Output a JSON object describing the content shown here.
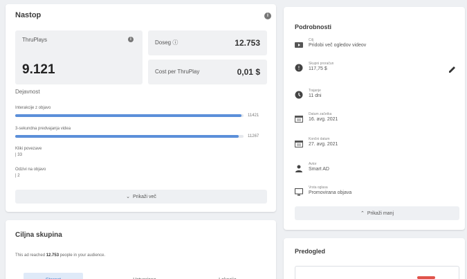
{
  "performance": {
    "title": "Nastop",
    "thruplays_label": "ThruPlays",
    "thruplays_value": "9.121",
    "reach_label": "Doseg",
    "reach_value": "12.753",
    "cpt_label": "Cost per ThruPlay",
    "cpt_value": "0,01 $",
    "activity_label": "Dejavnost",
    "activity": [
      {
        "label": "Interakcije z objavo",
        "value": "11421",
        "fraction": 0.99
      },
      {
        "label": "3-sekundna predvajanja videa",
        "value": "11267",
        "fraction": 0.98
      },
      {
        "label": "Kliki povezave",
        "value": "33"
      },
      {
        "label": "Odzivi na objavo",
        "value": "2"
      }
    ],
    "see_more": "Prikaži več"
  },
  "details": {
    "title": "Podrobnosti",
    "rows": [
      {
        "label": "Cilj",
        "value": "Pridobi več ogledov videov",
        "icon": "video-icon"
      },
      {
        "label": "Skupni proračun",
        "value": "117,75 $",
        "icon": "budget-icon"
      },
      {
        "label": "Trajanje",
        "value": "11 dni",
        "icon": "clock-icon"
      },
      {
        "label": "Datum začetka",
        "value": "16. avg. 2021",
        "icon": "calendar-icon"
      },
      {
        "label": "Končni datum",
        "value": "27. avg. 2021",
        "icon": "calendar-icon"
      },
      {
        "label": "Avtor",
        "value": "Smart AD",
        "icon": "person-icon"
      },
      {
        "label": "Vrsta oglasa",
        "value": "Promovirana objava",
        "icon": "monitor-icon"
      }
    ],
    "see_more": "Prikaži manj"
  },
  "audience": {
    "title": "Ciljna skupina",
    "text_prefix": "This ad reached",
    "text_value": "12.753",
    "text_suffix": "people in your audience.",
    "tabs": [
      "Starost",
      "Ustvarjeno",
      "Lokacija"
    ]
  },
  "preview": {
    "title": "Predogled"
  },
  "colors": {
    "bar": "#5b8fd9",
    "tab_active_bg": "#dfeaf8",
    "tab_active_text": "#4a7fc9"
  }
}
